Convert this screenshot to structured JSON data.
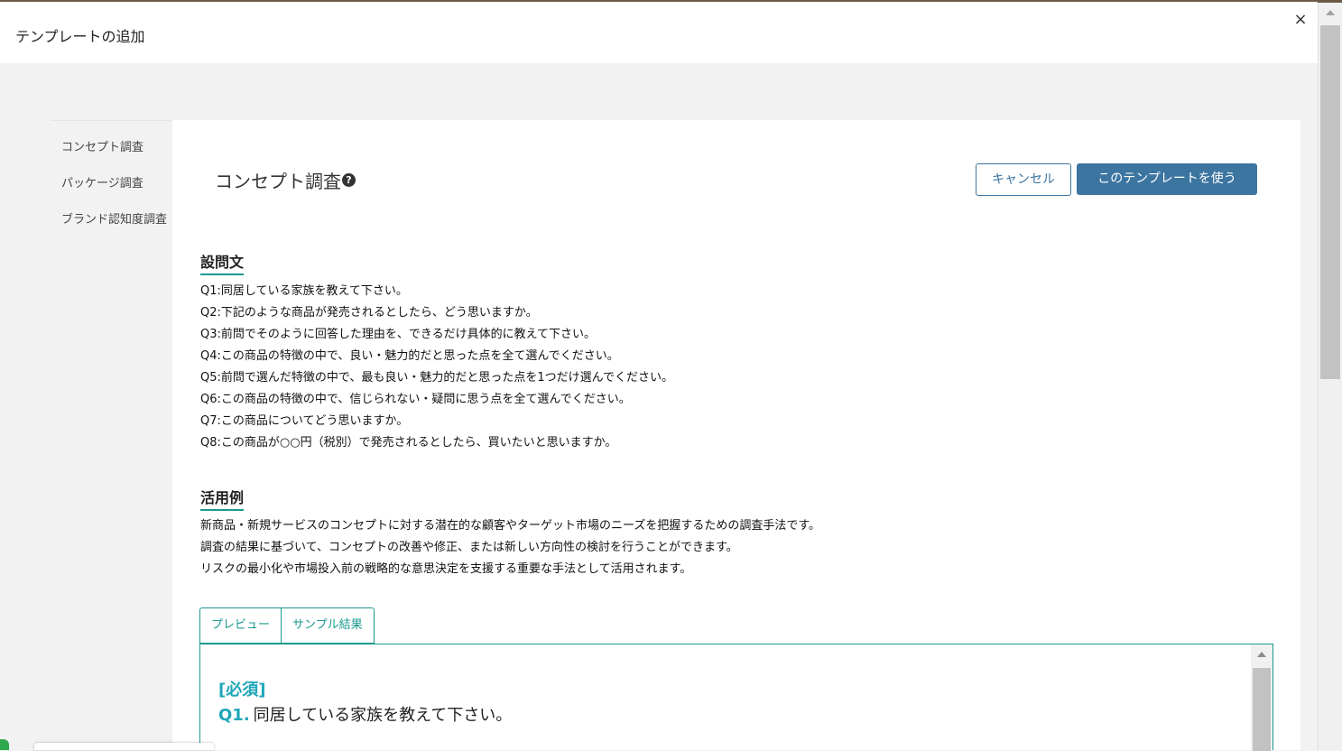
{
  "modal": {
    "title": "テンプレートの追加",
    "close_label": "×"
  },
  "sidebar": {
    "items": [
      {
        "label": "コンセプト調査"
      },
      {
        "label": "パッケージ調査"
      },
      {
        "label": "ブランド認知度調査"
      }
    ]
  },
  "main": {
    "title": "コンセプト調査",
    "help_glyph": "?",
    "cancel_label": "キャンセル",
    "use_label": "このテンプレートを使う",
    "questions_heading": "設問文",
    "questions": [
      "Q1:同居している家族を教えて下さい。",
      "Q2:下記のような商品が発売されるとしたら、どう思いますか。",
      "Q3:前問でそのように回答した理由を、できるだけ具体的に教えて下さい。",
      "Q4:この商品の特徴の中で、良い・魅力的だと思った点を全て選んでください。",
      "Q5:前問で選んだ特徴の中で、最も良い・魅力的だと思った点を1つだけ選んでください。",
      "Q6:この商品の特徴の中で、信じられない・疑問に思う点を全て選んでください。",
      "Q7:この商品についてどう思いますか。",
      "Q8:この商品が○○円（税別）で発売されるとしたら、買いたいと思いますか。"
    ],
    "usage_heading": "活用例",
    "usage_lines": [
      "新商品・新規サービスのコンセプトに対する潜在的な顧客やターゲット市場のニーズを把握するための調査手法です。",
      "調査の結果に基づいて、コンセプトの改善や修正、または新しい方向性の検討を行うことができます。",
      "リスクの最小化や市場投入前の戦略的な意思決定を支援する重要な手法として活用されます。"
    ],
    "tabs": [
      {
        "label": "プレビュー"
      },
      {
        "label": "サンプル結果"
      }
    ],
    "preview": {
      "required_label": "[必須]",
      "q_number": "Q1.",
      "q_text": "同居している家族を教えて下さい。"
    }
  },
  "colors": {
    "accent": "#3d75a1",
    "teal": "#1a9a8e",
    "question_blue": "#1ea6b8"
  }
}
